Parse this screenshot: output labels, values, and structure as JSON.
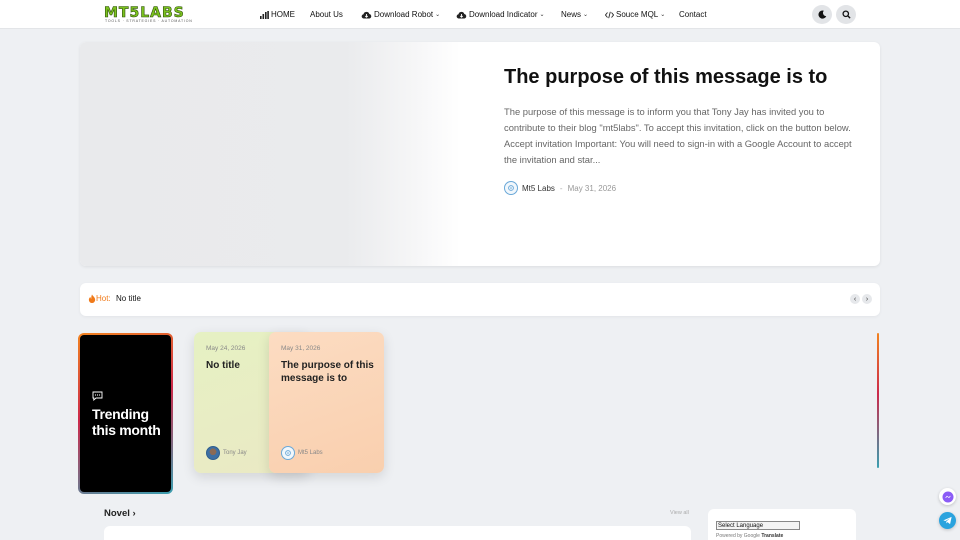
{
  "header": {
    "logo_text": "MT5LABS",
    "logo_tagline": "TOOLS · STRATEGIES · AUTOMATION",
    "nav": [
      {
        "label": "HOME",
        "icon": "chart-bar-icon"
      },
      {
        "label": "About Us"
      },
      {
        "label": "Download Robot",
        "icon": "cloud-download-icon"
      },
      {
        "label": "Download Indicator",
        "icon": "cloud-download-icon"
      },
      {
        "label": "News"
      },
      {
        "label": "Souce MQL",
        "icon": "code-icon"
      },
      {
        "label": "Contact"
      }
    ],
    "theme_toggle_icon": "moon-icon",
    "search_icon": "search-icon"
  },
  "hero": {
    "title": "The purpose of this message is to",
    "excerpt": "The purpose of this message is to inform you that Tony Jay has invited you to contribute to their blog \"mt5labs\". To accept this invitation, click on the button below. Accept invitation Important: You will need to sign-in with a Google Account to accept the invitation and star...",
    "author": "Mt5 Labs",
    "separator": "-",
    "date": "May 31, 2026"
  },
  "ticker": {
    "label": "Hot:",
    "item": "No title",
    "prev": "‹",
    "next": "›"
  },
  "trending": {
    "heading": "Trending this month",
    "cards": [
      {
        "date": "May 24, 2026",
        "title": "No title",
        "author": "Tony Jay",
        "color": "#e3efbf"
      },
      {
        "date": "May 31, 2026",
        "title": "The purpose of this message is to",
        "author": "Mt5 Labs",
        "color": "#fbd3b6"
      }
    ]
  },
  "novel": {
    "title": "Novel",
    "arrow": "›",
    "view_all": "View all"
  },
  "translate": {
    "select_label": "Select Language",
    "powered_by": "Powered by",
    "google": "Google",
    "translate": "Translate"
  },
  "colors": {
    "accent_orange": "#f2831f",
    "accent_red": "#cc2a4b",
    "accent_teal": "#3a9fb0",
    "logo_green": "#7cc31f",
    "messenger": "#8b5cf6",
    "telegram": "#2aa3de"
  }
}
